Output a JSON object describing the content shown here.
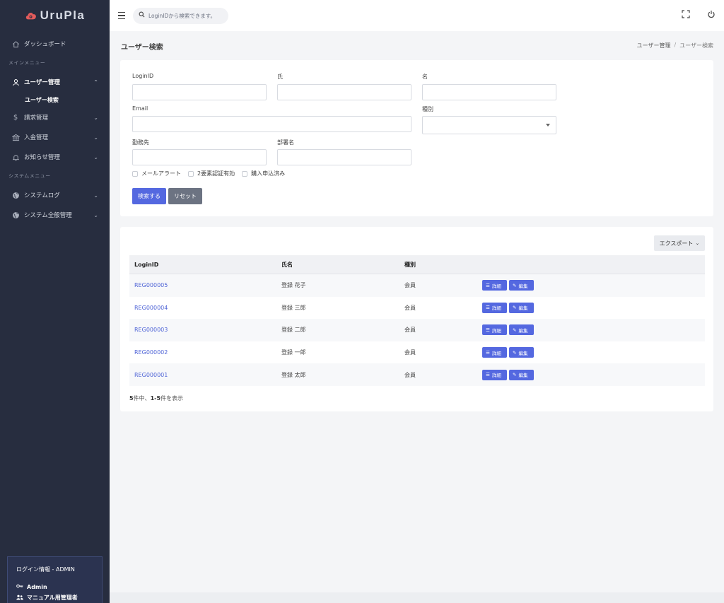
{
  "brand": {
    "name": "UruPla",
    "color": "#e25b5b"
  },
  "search": {
    "placeholder": "LoginIDから検索できます。"
  },
  "sidebar": {
    "dashboard": "ダッシュボード",
    "section_main": "メインメニュー",
    "user_mgmt": "ユーザー管理",
    "user_search": "ユーザー検索",
    "billing": "請求管理",
    "payment": "入金管理",
    "notice": "お知らせ管理",
    "section_system": "システムメニュー",
    "system_log": "システムログ",
    "system_mgmt": "システム全般管理",
    "login_info": "ログイン情報 - ADMIN",
    "login_user": "Admin",
    "login_role": "マニュアル用管理者"
  },
  "page": {
    "title": "ユーザー検索",
    "breadcrumb_parent": "ユーザー管理",
    "breadcrumb_sep": "/",
    "breadcrumb_current": "ユーザー検索"
  },
  "form": {
    "loginid_label": "LoginID",
    "lastname_label": "氏",
    "firstname_label": "名",
    "email_label": "Email",
    "type_label": "種別",
    "company_label": "勤務先",
    "department_label": "部署名",
    "check_mail_alert": "メールアラート",
    "check_2fa": "2要素認証有効",
    "check_purchase": "購入申込済み",
    "search_button": "検索する",
    "reset_button": "リセット"
  },
  "results": {
    "export_label": "エクスポート",
    "columns": [
      "LoginID",
      "氏名",
      "種別"
    ],
    "detail_label": "詳細",
    "edit_label": "編集",
    "rows": [
      {
        "loginid": "REG000005",
        "name": "登録 花子",
        "type": "会員"
      },
      {
        "loginid": "REG000004",
        "name": "登録 三郎",
        "type": "会員"
      },
      {
        "loginid": "REG000003",
        "name": "登録 二郎",
        "type": "会員"
      },
      {
        "loginid": "REG000002",
        "name": "登録 一郎",
        "type": "会員"
      },
      {
        "loginid": "REG000001",
        "name": "登録 太郎",
        "type": "会員"
      }
    ],
    "count_total": "5",
    "count_mid": "件中、",
    "count_range": "1-5",
    "count_suffix": "件を表示"
  }
}
